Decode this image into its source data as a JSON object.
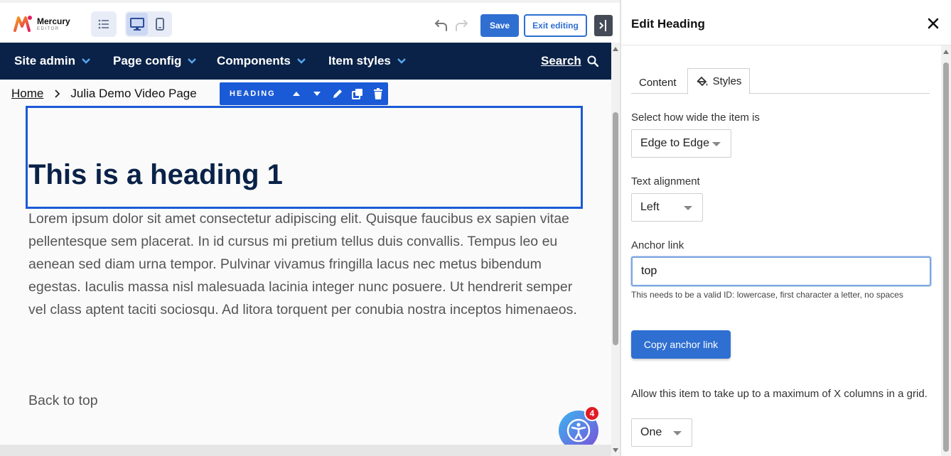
{
  "app": {
    "brand": "Mercury",
    "brand_sub": "EDITOR"
  },
  "toolbar": {
    "save_label": "Save",
    "exit_label": "Exit editing"
  },
  "site_nav": {
    "items": [
      {
        "label": "Site admin"
      },
      {
        "label": "Page config"
      },
      {
        "label": "Components"
      },
      {
        "label": "Item styles"
      }
    ],
    "search_label": "Search"
  },
  "breadcrumb": {
    "home": "Home",
    "current": "Julia Demo Video Page"
  },
  "component_toolbar": {
    "label": "HEADING"
  },
  "content": {
    "heading": "This is a heading 1",
    "body": "Lorem ipsum dolor sit amet consectetur adipiscing elit. Quisque faucibus ex sapien vitae pellentesque sem placerat. In id cursus mi pretium tellus duis convallis. Tempus leo eu aenean sed diam urna tempor. Pulvinar vivamus fringilla lacus nec metus bibendum egestas. Iaculis massa nisl malesuada lacinia integer nunc posuere. Ut hendrerit semper vel class aptent taciti sociosqu. Ad litora torquent per conubia nostra inceptos himenaeos.",
    "back_to_top": "Back to top"
  },
  "accessibility": {
    "badge_count": "4"
  },
  "panel": {
    "title": "Edit Heading",
    "tabs": [
      {
        "label": "Content"
      },
      {
        "label": "Styles"
      }
    ],
    "width_label": "Select how wide the item is",
    "width_value": "Edge to Edge",
    "align_label": "Text alignment",
    "align_value": "Left",
    "anchor_label": "Anchor link",
    "anchor_value": "top",
    "anchor_help": "This needs to be a valid ID: lowercase, first character a letter, no spaces",
    "copy_label": "Copy anchor link",
    "cols_label": "Allow this item to take up to a maximum of X columns in a grid.",
    "cols_value": "One"
  },
  "colors": {
    "nav_bg": "#0a2248",
    "accent": "#2f6fd1",
    "selection": "#1a5ad6"
  }
}
